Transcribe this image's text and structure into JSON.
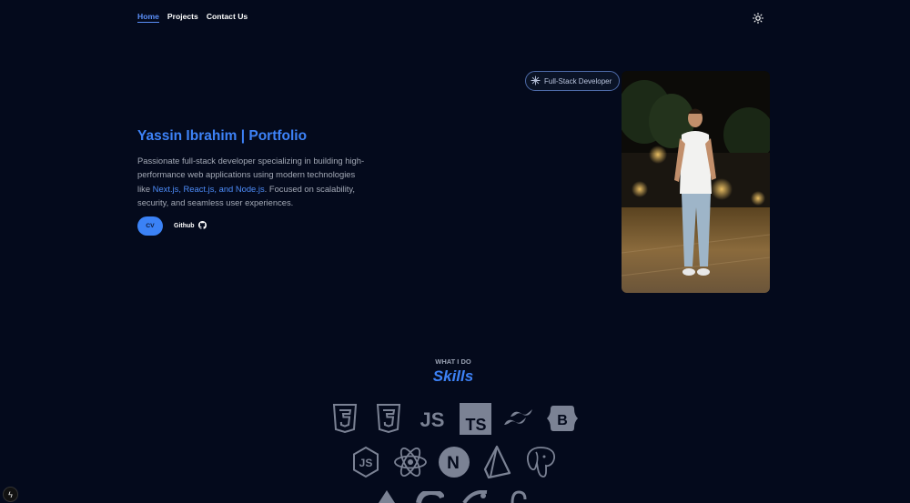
{
  "nav": {
    "items": [
      {
        "label": "Home",
        "active": true
      },
      {
        "label": "Projects",
        "active": false
      },
      {
        "label": "Contact Us",
        "active": false
      }
    ],
    "theme_icon": "sun-icon"
  },
  "hero": {
    "title": "Yassin Ibrahim | Portfolio",
    "desc_before": "Passionate full-stack developer specializing in building high-performance web applications using modern technologies like ",
    "desc_highlight": "Next.js, React.js, and Node.js",
    "desc_after": ". Focused on scalability, security, and seamless user experiences.",
    "cv_label": "CV",
    "github_label": "Github",
    "badge_label": "Full-Stack Developer"
  },
  "skills": {
    "kicker": "WHAT I DO",
    "title": "Skills",
    "row1": [
      "html5-icon",
      "css3-icon",
      "javascript-icon",
      "typescript-icon",
      "tailwind-icon",
      "bootstrap-icon"
    ],
    "row2": [
      "nodejs-icon",
      "react-icon",
      "nextjs-icon",
      "prisma-icon",
      "postgresql-icon"
    ],
    "ts_text": "TS",
    "js_text": "JS",
    "b_text": "B",
    "n_text": "N"
  },
  "colors": {
    "accent": "#3d82f7",
    "background": "#040a1c",
    "icon": "#7b8294"
  }
}
